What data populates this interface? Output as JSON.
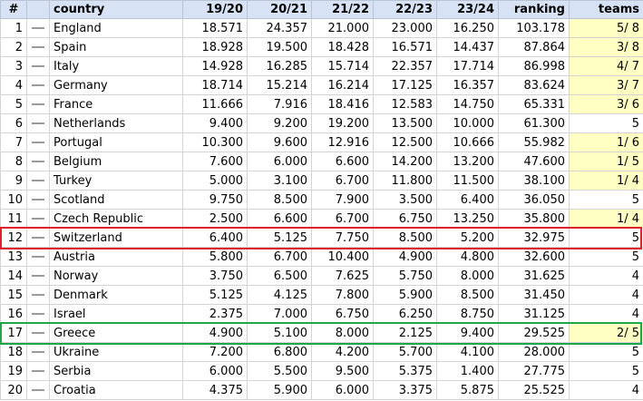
{
  "headers": {
    "rank": "#",
    "country": "country",
    "y1": "19/20",
    "y2": "20/21",
    "y3": "21/22",
    "y4": "22/23",
    "y5": "23/24",
    "ranking": "ranking",
    "teams": "teams"
  },
  "movement_icon": "no-change-dash-icon",
  "highlight_colors": {
    "teams_cell": "#ffffc4",
    "header_bg": "#d7e3f4",
    "switzerland_box": "#e0212b",
    "greece_box": "#1fa64a"
  },
  "rows": [
    {
      "rank": "1",
      "country": "England",
      "y1": "18.571",
      "y2": "24.357",
      "y3": "21.000",
      "y4": "23.000",
      "y5": "16.250",
      "ranking": "103.178",
      "teams": "5/ 8",
      "teams_highlight": true
    },
    {
      "rank": "2",
      "country": "Spain",
      "y1": "18.928",
      "y2": "19.500",
      "y3": "18.428",
      "y4": "16.571",
      "y5": "14.437",
      "ranking": "87.864",
      "teams": "3/ 8",
      "teams_highlight": true
    },
    {
      "rank": "3",
      "country": "Italy",
      "y1": "14.928",
      "y2": "16.285",
      "y3": "15.714",
      "y4": "22.357",
      "y5": "17.714",
      "ranking": "86.998",
      "teams": "4/ 7",
      "teams_highlight": true
    },
    {
      "rank": "4",
      "country": "Germany",
      "y1": "18.714",
      "y2": "15.214",
      "y3": "16.214",
      "y4": "17.125",
      "y5": "16.357",
      "ranking": "83.624",
      "teams": "3/ 7",
      "teams_highlight": true
    },
    {
      "rank": "5",
      "country": "France",
      "y1": "11.666",
      "y2": "7.916",
      "y3": "18.416",
      "y4": "12.583",
      "y5": "14.750",
      "ranking": "65.331",
      "teams": "3/ 6",
      "teams_highlight": true
    },
    {
      "rank": "6",
      "country": "Netherlands",
      "y1": "9.400",
      "y2": "9.200",
      "y3": "19.200",
      "y4": "13.500",
      "y5": "10.000",
      "ranking": "61.300",
      "teams": "5",
      "teams_highlight": false
    },
    {
      "rank": "7",
      "country": "Portugal",
      "y1": "10.300",
      "y2": "9.600",
      "y3": "12.916",
      "y4": "12.500",
      "y5": "10.666",
      "ranking": "55.982",
      "teams": "1/ 6",
      "teams_highlight": true
    },
    {
      "rank": "8",
      "country": "Belgium",
      "y1": "7.600",
      "y2": "6.000",
      "y3": "6.600",
      "y4": "14.200",
      "y5": "13.200",
      "ranking": "47.600",
      "teams": "1/ 5",
      "teams_highlight": true
    },
    {
      "rank": "9",
      "country": "Turkey",
      "y1": "5.000",
      "y2": "3.100",
      "y3": "6.700",
      "y4": "11.800",
      "y5": "11.500",
      "ranking": "38.100",
      "teams": "1/ 4",
      "teams_highlight": true
    },
    {
      "rank": "10",
      "country": "Scotland",
      "y1": "9.750",
      "y2": "8.500",
      "y3": "7.900",
      "y4": "3.500",
      "y5": "6.400",
      "ranking": "36.050",
      "teams": "5",
      "teams_highlight": false
    },
    {
      "rank": "11",
      "country": "Czech Republic",
      "y1": "2.500",
      "y2": "6.600",
      "y3": "6.700",
      "y4": "6.750",
      "y5": "13.250",
      "ranking": "35.800",
      "teams": "1/ 4",
      "teams_highlight": true
    },
    {
      "rank": "12",
      "country": "Switzerland",
      "y1": "6.400",
      "y2": "5.125",
      "y3": "7.750",
      "y4": "8.500",
      "y5": "5.200",
      "ranking": "32.975",
      "teams": "5",
      "teams_highlight": false
    },
    {
      "rank": "13",
      "country": "Austria",
      "y1": "5.800",
      "y2": "6.700",
      "y3": "10.400",
      "y4": "4.900",
      "y5": "4.800",
      "ranking": "32.600",
      "teams": "5",
      "teams_highlight": false
    },
    {
      "rank": "14",
      "country": "Norway",
      "y1": "3.750",
      "y2": "6.500",
      "y3": "7.625",
      "y4": "5.750",
      "y5": "8.000",
      "ranking": "31.625",
      "teams": "4",
      "teams_highlight": false
    },
    {
      "rank": "15",
      "country": "Denmark",
      "y1": "5.125",
      "y2": "4.125",
      "y3": "7.800",
      "y4": "5.900",
      "y5": "8.500",
      "ranking": "31.450",
      "teams": "4",
      "teams_highlight": false
    },
    {
      "rank": "16",
      "country": "Israel",
      "y1": "2.375",
      "y2": "7.000",
      "y3": "6.750",
      "y4": "6.250",
      "y5": "8.750",
      "ranking": "31.125",
      "teams": "4",
      "teams_highlight": false
    },
    {
      "rank": "17",
      "country": "Greece",
      "y1": "4.900",
      "y2": "5.100",
      "y3": "8.000",
      "y4": "2.125",
      "y5": "9.400",
      "ranking": "29.525",
      "teams": "2/ 5",
      "teams_highlight": true
    },
    {
      "rank": "18",
      "country": "Ukraine",
      "y1": "7.200",
      "y2": "6.800",
      "y3": "4.200",
      "y4": "5.700",
      "y5": "4.100",
      "ranking": "28.000",
      "teams": "5",
      "teams_highlight": false
    },
    {
      "rank": "19",
      "country": "Serbia",
      "y1": "6.000",
      "y2": "5.500",
      "y3": "9.500",
      "y4": "5.375",
      "y5": "1.400",
      "ranking": "27.775",
      "teams": "5",
      "teams_highlight": false
    },
    {
      "rank": "20",
      "country": "Croatia",
      "y1": "4.375",
      "y2": "5.900",
      "y3": "6.000",
      "y4": "3.375",
      "y5": "5.875",
      "ranking": "25.525",
      "teams": "4",
      "teams_highlight": false
    }
  ]
}
